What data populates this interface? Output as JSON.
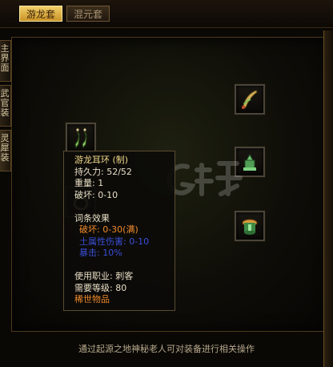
{
  "tabs": [
    {
      "label": "游龙套",
      "active": true
    },
    {
      "label": "混元套",
      "active": false
    }
  ],
  "side_tabs": [
    {
      "label": "主界面"
    },
    {
      "label": "武官装"
    },
    {
      "label": "灵犀装"
    }
  ],
  "slots": [
    {
      "icon": "earring-icon"
    },
    {
      "icon": "ring-icon"
    },
    {
      "icon": "feather-pendant-icon"
    },
    {
      "icon": "jade-seal-icon"
    },
    {
      "icon": "bracelet-icon"
    }
  ],
  "tooltip": {
    "item_name": "游龙耳环 (制)",
    "durability": "持久力: 52/52",
    "weight": "重量: 1",
    "damage": "破坏: 0-10",
    "affix_header": "词条效果",
    "affix_1": "破坏: 0-30(满)",
    "affix_2": "土属性伤害: 0-10",
    "affix_3": "暴击: 10%",
    "job": "使用职业: 刺客",
    "level": "需要等级: 80",
    "rarity": "稀世物品"
  },
  "footer_text": "通过起源之地神秘老人可对装备进行相关操作",
  "colors": {
    "accent_gold": "#f2cf69",
    "rarity_orange": "#f08a2c",
    "affix_blue": "#3a4fd8"
  }
}
